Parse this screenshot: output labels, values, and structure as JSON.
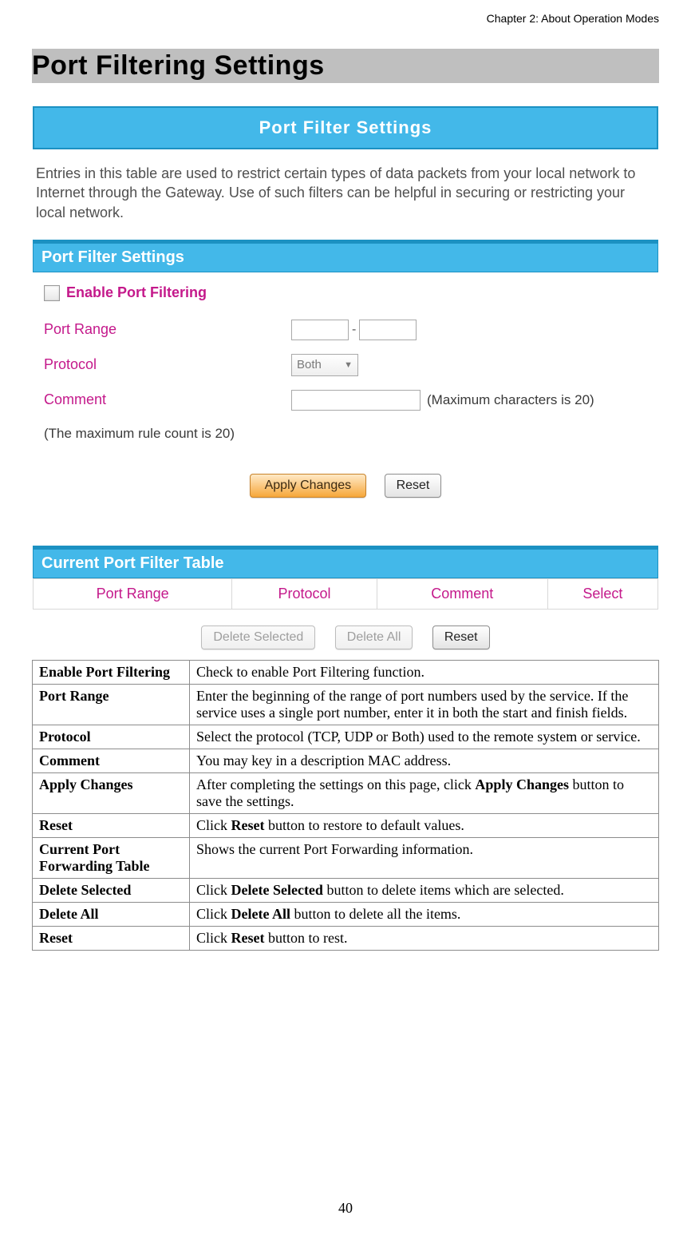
{
  "header": {
    "chapter": "Chapter 2: About Operation Modes"
  },
  "section_title": "Port Filtering Settings",
  "embed": {
    "title_bar": "Port Filter Settings",
    "intro": "Entries in this table are used to restrict certain types of data packets from your local network to Internet through the Gateway. Use of such filters can be helpful in securing or restricting your local network.",
    "panel_header": "Port Filter Settings",
    "enable_label": "Enable Port Filtering",
    "labels": {
      "port_range": "Port Range",
      "protocol": "Protocol",
      "comment": "Comment"
    },
    "protocol_value": "Both",
    "comment_hint": "(Maximum characters is 20)",
    "rule_note": "(The maximum rule count is 20)",
    "buttons": {
      "apply": "Apply Changes",
      "reset": "Reset",
      "delete_selected": "Delete Selected",
      "delete_all": "Delete All"
    },
    "table_header": "Current Port Filter Table",
    "columns": [
      "Port Range",
      "Protocol",
      "Comment",
      "Select"
    ]
  },
  "definitions": [
    {
      "term": "Enable Port Filtering",
      "desc": "Check to enable Port Filtering function."
    },
    {
      "term": "Port Range",
      "desc": "Enter the beginning of the range of port numbers used by the service. If the service uses a single port number, enter it in both the start and finish fields."
    },
    {
      "term": "Protocol",
      "desc": "Select the protocol (TCP, UDP or Both) used to the remote system or service."
    },
    {
      "term": "Comment",
      "desc": "You may key in a description MAC address."
    },
    {
      "term": "Apply Changes",
      "desc_pre": "After completing the settings on this page, click ",
      "bold": "Apply Changes",
      "desc_post": " button to save the settings."
    },
    {
      "term": "Reset",
      "desc_pre": "Click ",
      "bold": "Reset",
      "desc_post": " button to restore to default values."
    },
    {
      "term": "Current Port Forwarding Table",
      "desc": "Shows the current Port Forwarding information."
    },
    {
      "term": "Delete Selected",
      "desc_pre": "Click ",
      "bold": "Delete Selected",
      "desc_post": " button to delete items which are selected."
    },
    {
      "term": "Delete All",
      "desc_pre": "Click ",
      "bold": "Delete All",
      "desc_post": " button to delete all the items."
    },
    {
      "term": "Reset",
      "desc_pre": "Click ",
      "bold": "Reset",
      "desc_post": " button to rest."
    }
  ],
  "page_number": "40"
}
